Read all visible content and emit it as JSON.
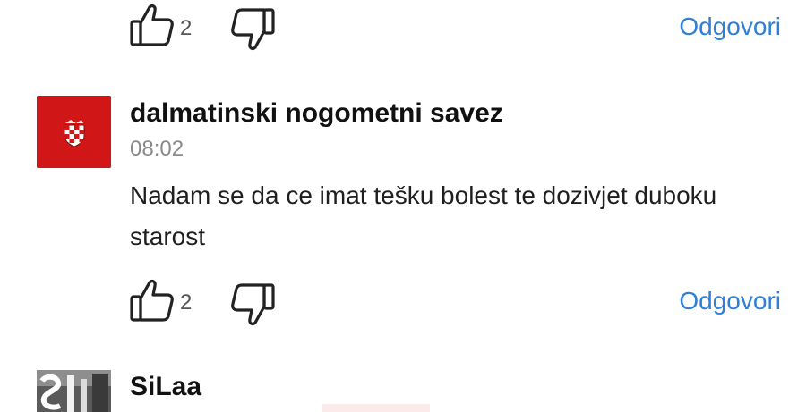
{
  "comments": [
    {
      "likes": "2",
      "reply_label": "Odgovori"
    },
    {
      "author": "dalmatinski nogometni savez",
      "time": "08:02",
      "text": "Nadam se da ce imat tešku bolest te dozivjet duboku starost",
      "likes": "2",
      "reply_label": "Odgovori",
      "avatar_color": "#d01616"
    },
    {
      "author": "SiLaa"
    }
  ],
  "colors": {
    "accent": "#2f7fd6",
    "muted": "#8a8a8a"
  },
  "icons": {
    "like": "thumbs-up-icon",
    "dislike": "thumbs-down-icon"
  }
}
